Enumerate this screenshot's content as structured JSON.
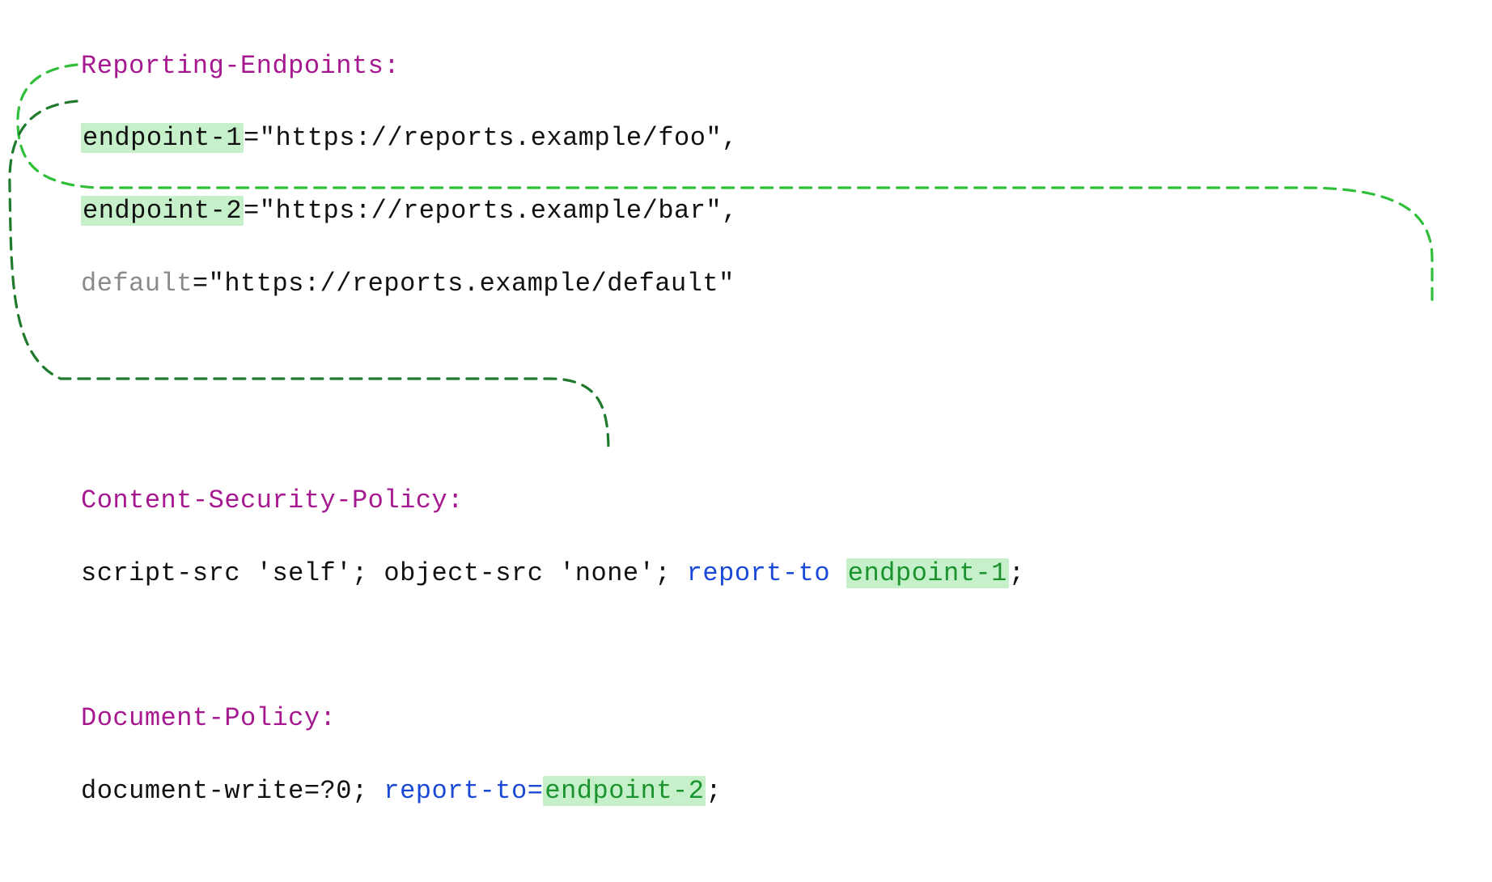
{
  "headers": {
    "reporting_endpoints": "Reporting-Endpoints:",
    "csp": "Content-Security-Policy:",
    "doc_policy": "Document-Policy:"
  },
  "endpoints": {
    "e1_name": "endpoint-1",
    "e1_url": "=\"https://reports.example/foo\",",
    "e2_name": "endpoint-2",
    "e2_url": "=\"https://reports.example/bar\",",
    "default_name": "default",
    "default_url": "=\"https://reports.example/default\""
  },
  "csp": {
    "directives": "script-src 'self'; object-src 'none'; ",
    "report_to": "report-to ",
    "target": "endpoint-1",
    "tail": ";"
  },
  "doc": {
    "directives": "document-write=?0; ",
    "report_to": "report-to=",
    "target": "endpoint-2",
    "tail": ";"
  },
  "colors": {
    "header": "#a6188f",
    "highlight_bg": "#c6f0c9",
    "green_text": "#1a932f",
    "keyword": "#1a49d6",
    "muted": "#8a8a8a",
    "dash_light": "#2fbf3a",
    "dash_dark": "#1f7a2b"
  }
}
